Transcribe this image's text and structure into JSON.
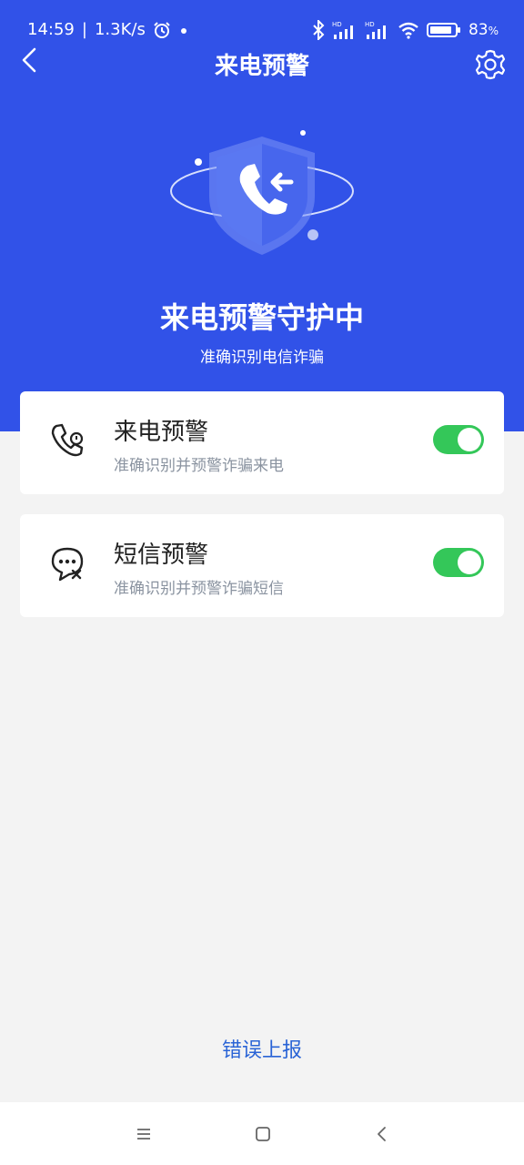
{
  "status_bar": {
    "time": "14:59",
    "separator": "|",
    "speed": "1.3K/s",
    "battery_pct": "83",
    "battery_unit": "%"
  },
  "nav": {
    "title": "来电预警"
  },
  "hero": {
    "title": "来电预警守护中",
    "subtitle": "准确识别电信诈骗"
  },
  "cards": [
    {
      "title": "来电预警",
      "desc": "准确识别并预警诈骗来电",
      "enabled": true,
      "icon": "phone-shield-icon"
    },
    {
      "title": "短信预警",
      "desc": "准确识别并预警诈骗短信",
      "enabled": true,
      "icon": "message-x-icon"
    }
  ],
  "footer": {
    "report_label": "错误上报"
  },
  "colors": {
    "primary": "#3152e8",
    "toggle_on": "#34c759",
    "link": "#2a64d6",
    "background": "#f3f3f3"
  }
}
